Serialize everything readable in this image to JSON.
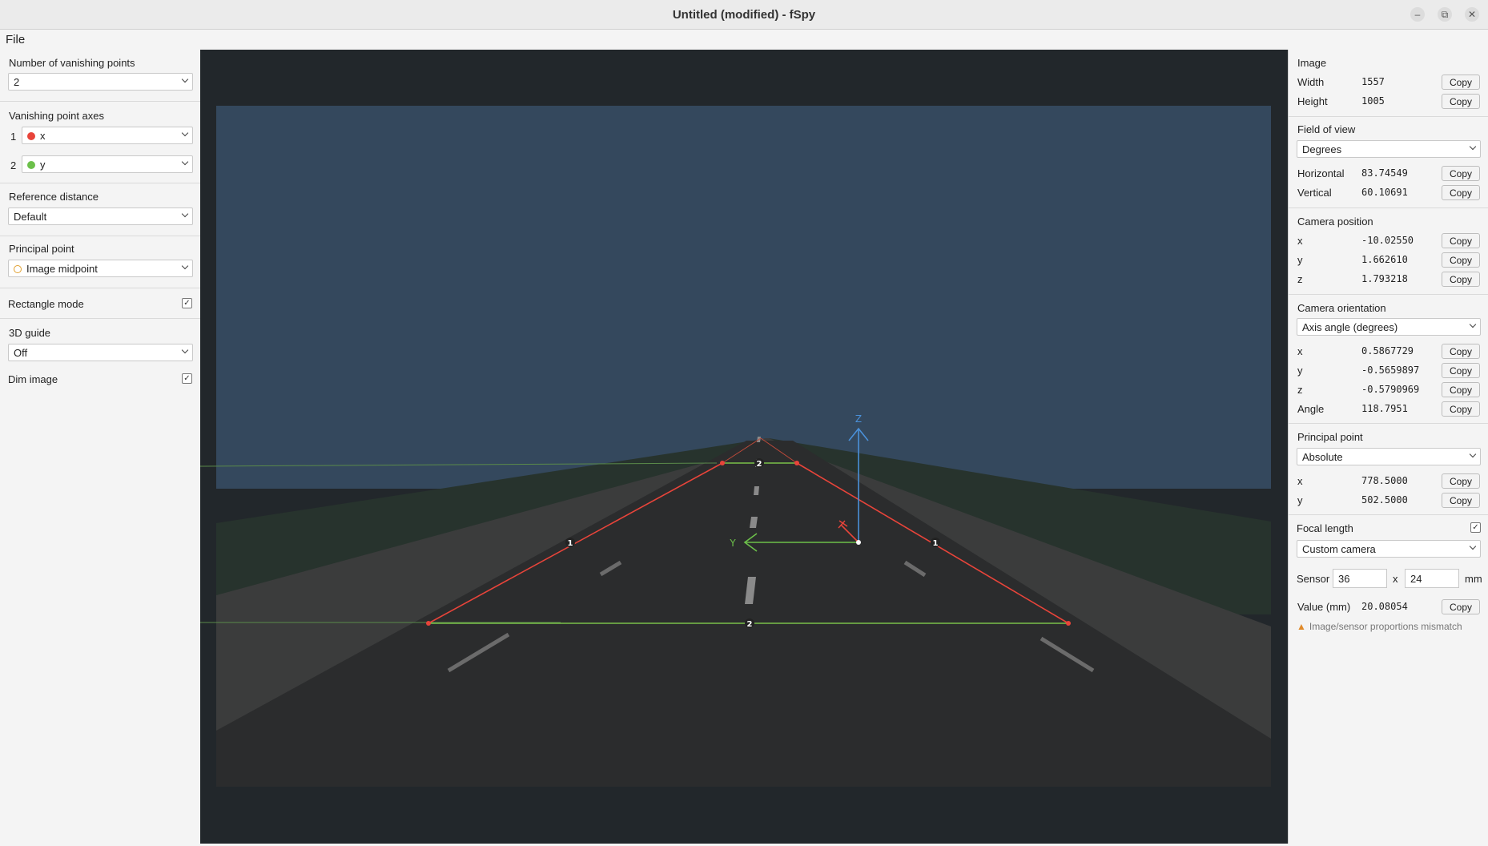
{
  "window": {
    "title": "Untitled (modified) - fSpy",
    "min": "–",
    "max": "⧉",
    "close": "✕"
  },
  "menu": {
    "file": "File"
  },
  "left": {
    "num_vp_label": "Number of vanishing points",
    "num_vp_value": "2",
    "vp_axes_label": "Vanishing point axes",
    "axis1_index": "1",
    "axis1_value": "x",
    "axis1_color": "#e8443a",
    "axis2_index": "2",
    "axis2_value": "y",
    "axis2_color": "#6cc04a",
    "ref_dist_label": "Reference distance",
    "ref_dist_value": "Default",
    "principal_label": "Principal point",
    "principal_value": "Image midpoint",
    "rect_mode_label": "Rectangle mode",
    "rect_mode_checked": true,
    "guide_label": "3D guide",
    "guide_value": "Off",
    "dim_label": "Dim image",
    "dim_checked": true
  },
  "viewport": {
    "vp_handle_1": "1",
    "vp_handle_2": "2",
    "axis_z": "Z",
    "axis_y": "Y"
  },
  "right": {
    "copy": "Copy",
    "image": {
      "title": "Image",
      "width_label": "Width",
      "width": "1557",
      "height_label": "Height",
      "height": "1005"
    },
    "fov": {
      "title": "Field of view",
      "unit": "Degrees",
      "h_label": "Horizontal",
      "h": "83.74549",
      "v_label": "Vertical",
      "v": "60.10691"
    },
    "campos": {
      "title": "Camera position",
      "x": "-10.02550",
      "y": "1.662610",
      "z": "1.793218"
    },
    "camori": {
      "title": "Camera orientation",
      "mode": "Axis angle (degrees)",
      "x": "0.5867729",
      "y": "-0.5659897",
      "z": "-0.5790969",
      "angle_label": "Angle",
      "angle": "118.7951"
    },
    "pp": {
      "title": "Principal point",
      "mode": "Absolute",
      "x": "778.5000",
      "y": "502.5000"
    },
    "focal": {
      "title": "Focal length",
      "camera": "Custom camera",
      "sensor_label": "Sensor",
      "sensor_w": "36",
      "sensor_x": "x",
      "sensor_h": "24",
      "sensor_unit": "mm",
      "value_label": "Value (mm)",
      "value": "20.08054",
      "warning": "Image/sensor proportions mismatch"
    },
    "labels": {
      "x": "x",
      "y": "y",
      "z": "z"
    }
  }
}
